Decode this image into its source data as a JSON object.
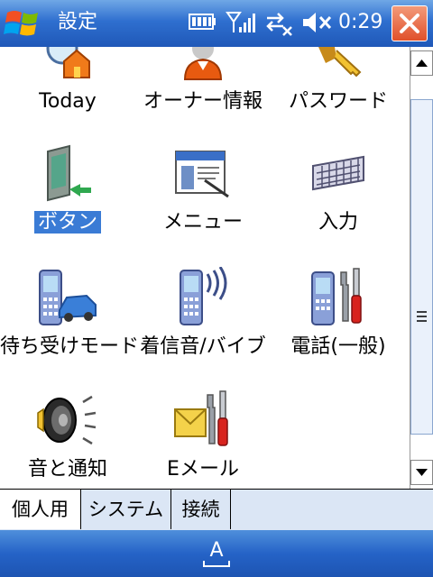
{
  "titlebar": {
    "title": "設定",
    "time": "0:29"
  },
  "items": [
    {
      "label": "Today",
      "icon": "today-icon"
    },
    {
      "label": "オーナー情報",
      "icon": "owner-info-icon"
    },
    {
      "label": "パスワード",
      "icon": "password-icon"
    },
    {
      "label": "ボタン",
      "icon": "buttons-icon",
      "selected": true
    },
    {
      "label": "メニュー",
      "icon": "menus-icon"
    },
    {
      "label": "入力",
      "icon": "input-keyboard-icon"
    },
    {
      "label": "待ち受けモード",
      "icon": "standby-mode-icon"
    },
    {
      "label": "着信音/バイブ",
      "icon": "ringtone-vibrate-icon"
    },
    {
      "label": "電話(一般)",
      "icon": "phone-general-icon"
    },
    {
      "label": "音と通知",
      "icon": "sounds-notifications-icon"
    },
    {
      "label": "Eメール",
      "icon": "email-settings-icon"
    }
  ],
  "tabs": [
    {
      "label": "個人用",
      "active": true
    },
    {
      "label": "システム"
    },
    {
      "label": "接続"
    }
  ],
  "bottombar": {
    "sip_label": "A"
  }
}
